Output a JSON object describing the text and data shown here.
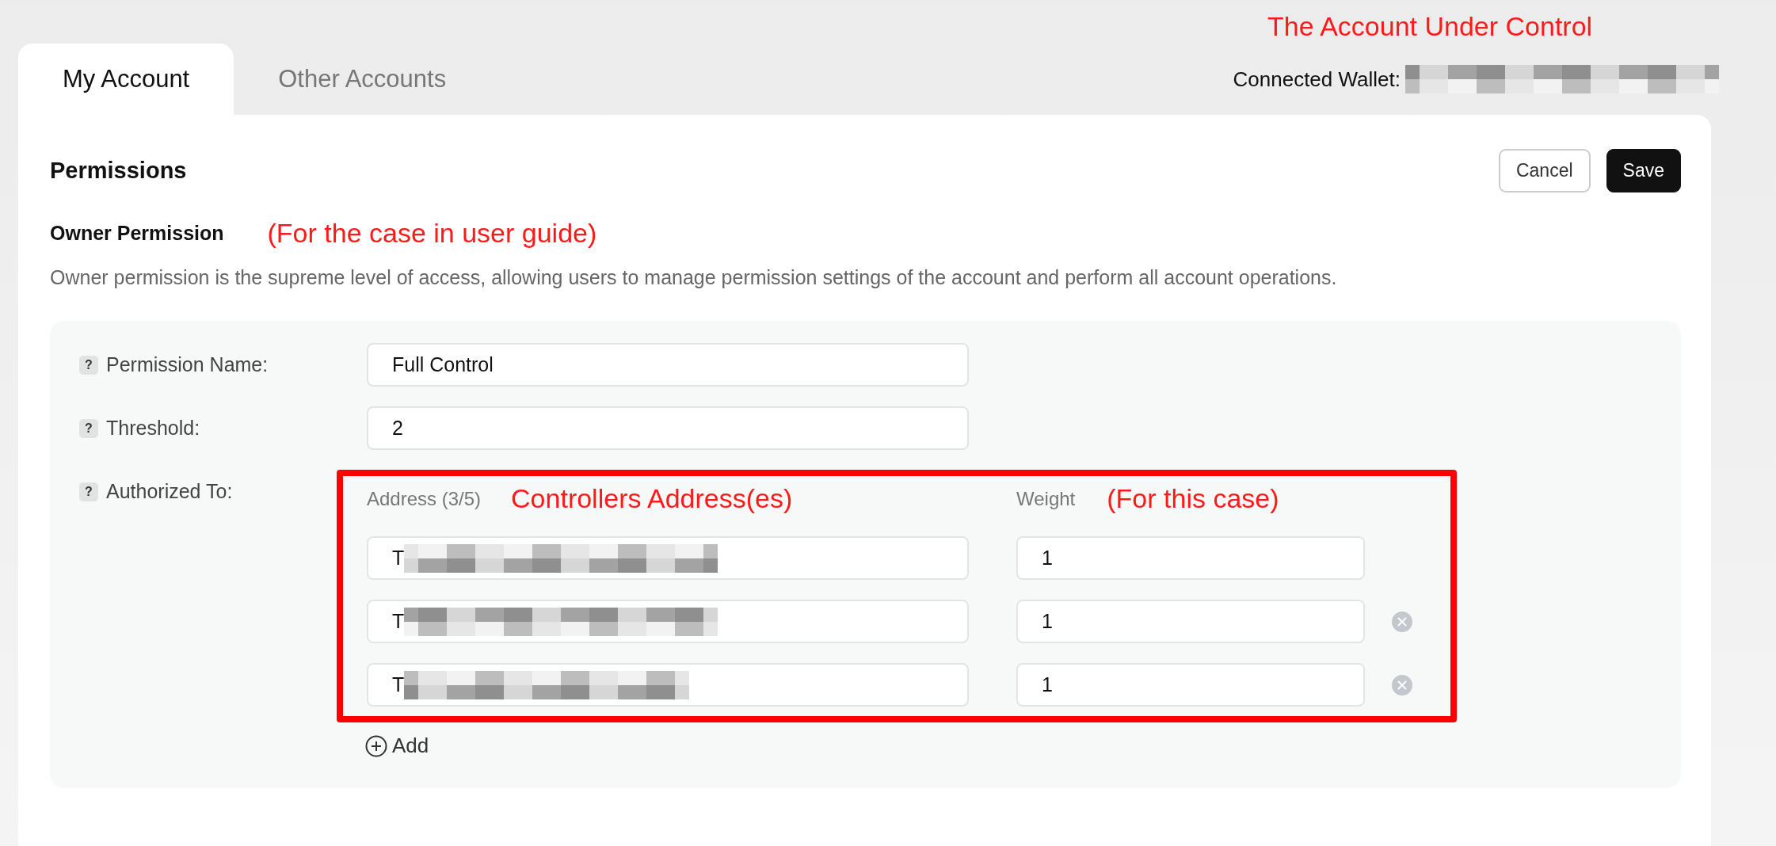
{
  "annotations": {
    "account": "The Account Under Control",
    "guide": "(For the case in user guide)",
    "controllers": "Controllers Address(es)",
    "this_case": "(For this case)"
  },
  "tabs": [
    {
      "label": "My Account",
      "selected": true
    },
    {
      "label": "Other Accounts",
      "selected": false
    }
  ],
  "connected_wallet": {
    "label": "Connected Wallet:"
  },
  "section": {
    "title": "Permissions",
    "buttons": [
      {
        "label": "Cancel",
        "kind": "secondary"
      },
      {
        "label": "Save",
        "kind": "primary"
      }
    ]
  },
  "owner_permission": {
    "title": "Owner Permission",
    "description": "Owner permission is the supreme level of access, allowing users to manage permission settings of the account and perform all account operations.",
    "fields": [
      {
        "help": "?",
        "label": "Permission Name:",
        "value": "Full Control"
      },
      {
        "help": "?",
        "label": "Threshold:",
        "value": "2"
      }
    ],
    "authorized_to": {
      "help": "?",
      "label": "Authorized To:",
      "address_header": "Address (3/5)",
      "weight_header": "Weight",
      "rows": [
        {
          "address": "T",
          "weight": "1",
          "removable": false
        },
        {
          "address": "T",
          "weight": "1",
          "removable": true
        },
        {
          "address": "T",
          "weight": "1",
          "removable": true
        }
      ],
      "add_label": "Add"
    }
  }
}
